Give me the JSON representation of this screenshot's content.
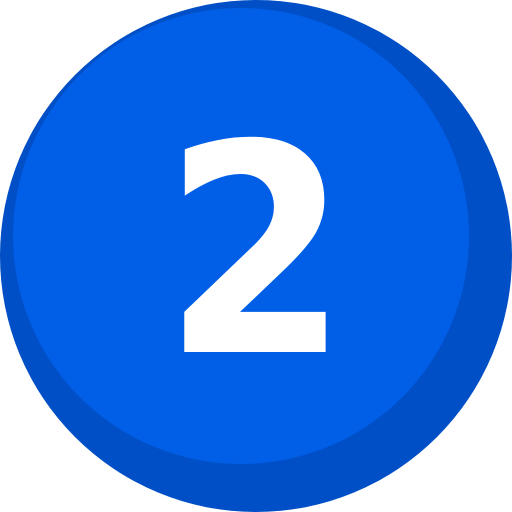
{
  "badge": {
    "number": "2",
    "icon": "number-two-circle-icon",
    "colors": {
      "main": "#005FE6",
      "shadow": "#004FC6",
      "numeral": "#FFFFFF"
    }
  }
}
